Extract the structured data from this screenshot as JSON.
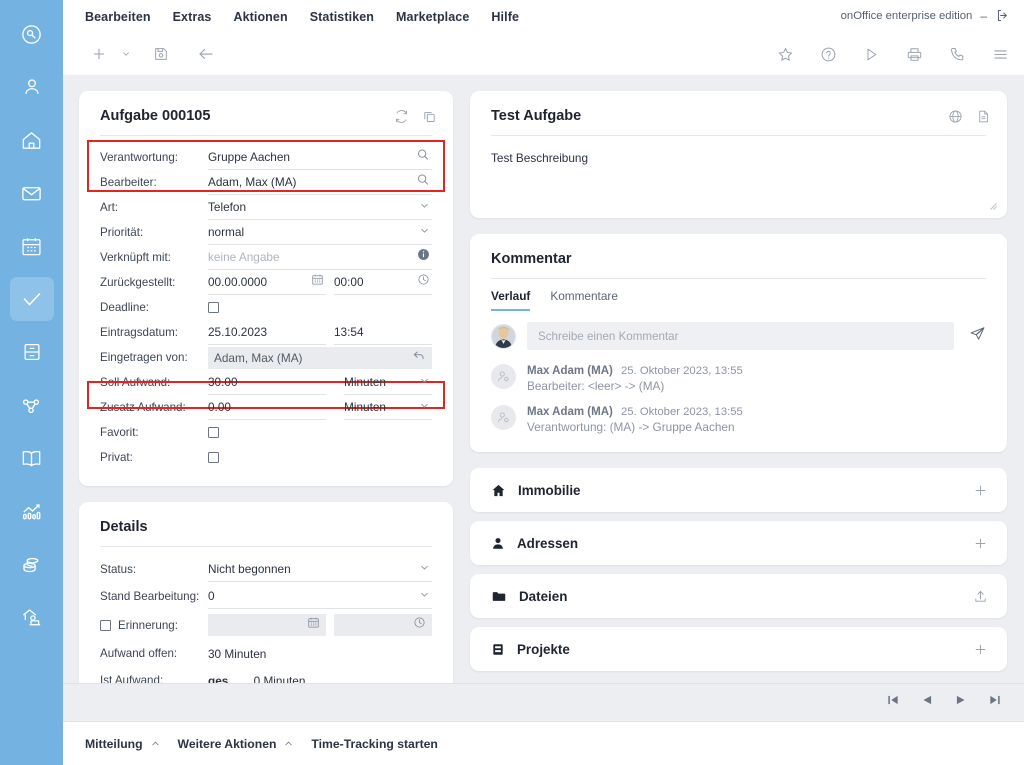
{
  "sidebar": {
    "items": [
      {
        "name": "logo-icon",
        "label": "onOffice Logo",
        "active": false
      },
      {
        "name": "contacts-icon",
        "label": "Adressen",
        "active": false
      },
      {
        "name": "properties-icon",
        "label": "Immobilien",
        "active": false
      },
      {
        "name": "mail-icon",
        "label": "E-Mail",
        "active": false
      },
      {
        "name": "calendar-icon",
        "label": "Kalender",
        "active": false
      },
      {
        "name": "tasks-icon",
        "label": "Aufgaben",
        "active": true
      },
      {
        "name": "archive-icon",
        "label": "Archiv",
        "active": false
      },
      {
        "name": "workflow-icon",
        "label": "Prozesse",
        "active": false
      },
      {
        "name": "book-icon",
        "label": "Exposés",
        "active": false
      },
      {
        "name": "statistics-icon",
        "label": "Statistiken",
        "active": false
      },
      {
        "name": "finance-icon",
        "label": "Finanzen",
        "active": false
      },
      {
        "name": "portal-icon",
        "label": "Portale",
        "active": false
      }
    ]
  },
  "topbar": {
    "menu": [
      "Bearbeiten",
      "Extras",
      "Aktionen",
      "Statistiken",
      "Marketplace",
      "Hilfe"
    ],
    "brand": "onOffice enterprise edition",
    "brand_dash": "–",
    "logout_icon": "logout-icon",
    "left_tools": [
      "plus-icon",
      "chevron-down-icon",
      "save-icon",
      "back-arrow-icon"
    ],
    "right_tools": [
      "star-icon",
      "help-icon",
      "play-icon",
      "print-icon",
      "phone-icon",
      "menu-icon"
    ]
  },
  "task_card": {
    "title": "Aufgabe 000105",
    "actions": [
      "refresh-icon",
      "copy-icon"
    ],
    "rows": [
      {
        "label": "Verantwortung:",
        "value": "Gruppe Aachen",
        "type": "search",
        "highlight": true
      },
      {
        "label": "Bearbeiter:",
        "value": "Adam, Max (MA)",
        "type": "search",
        "highlight": true
      },
      {
        "label": "Art:",
        "value": "Telefon",
        "type": "select"
      },
      {
        "label": "Priorität:",
        "value": "normal",
        "type": "select"
      },
      {
        "label": "Verknüpft mit:",
        "value": "keine Angabe",
        "type": "info",
        "muted": true
      },
      {
        "label": "Zurückgestellt:",
        "value": "00.00.0000",
        "value2": "00:00",
        "type": "datetime"
      },
      {
        "label": "Deadline:",
        "value": "",
        "type": "checkbox"
      },
      {
        "label": "Eintragsdatum:",
        "value": "25.10.2023",
        "value2": "13:54",
        "type": "readonly-datetime"
      },
      {
        "label": "Eingetragen von:",
        "value": "Adam, Max (MA)",
        "type": "readonly-undo",
        "highlight": true
      },
      {
        "label": "Soll Aufwand:",
        "value": "30.00",
        "value2": "Minuten",
        "type": "amount"
      },
      {
        "label": "Zusatz Aufwand:",
        "value": "0.00",
        "value2": "Minuten",
        "type": "amount"
      },
      {
        "label": "Favorit:",
        "value": "",
        "type": "checkbox"
      },
      {
        "label": "Privat:",
        "value": "",
        "type": "checkbox"
      }
    ]
  },
  "details_card": {
    "title": "Details",
    "rows": [
      {
        "label": "Status:",
        "value": "Nicht begonnen",
        "type": "select"
      },
      {
        "label": "Stand Bearbeitung:",
        "value": "0",
        "type": "select"
      },
      {
        "label": "Erinnerung:",
        "value": "",
        "value2": "",
        "type": "reminder",
        "checkbox_label": true
      },
      {
        "label": "Aufwand offen:",
        "value": "30 Minuten",
        "type": "text"
      },
      {
        "label": "Ist Aufwand:",
        "value": "ges.",
        "value2": "0 Minuten",
        "type": "text2"
      }
    ]
  },
  "description_card": {
    "title": "Test Aufgabe",
    "actions": [
      "globe-icon",
      "document-icon"
    ],
    "body": "Test Beschreibung"
  },
  "comment_card": {
    "title": "Kommentar",
    "tabs": [
      {
        "label": "Verlauf",
        "active": true
      },
      {
        "label": "Kommentare",
        "active": false
      }
    ],
    "input_placeholder": "Schreibe einen Kommentar",
    "send_icon": "send-icon",
    "log": [
      {
        "author": "Max Adam (MA)",
        "timestamp": "25. Oktober 2023, 13:55",
        "text": "Bearbeiter: <leer> -> (MA)"
      },
      {
        "author": "Max Adam (MA)",
        "timestamp": "25. Oktober 2023, 13:55",
        "text": "Verantwortung: (MA) -> Gruppe Aachen"
      }
    ]
  },
  "accordions": [
    {
      "label": "Immobilie",
      "icon": "home-icon",
      "action": "plus-icon"
    },
    {
      "label": "Adressen",
      "icon": "person-icon",
      "action": "plus-icon"
    },
    {
      "label": "Dateien",
      "icon": "folder-icon",
      "action": "upload-icon"
    },
    {
      "label": "Projekte",
      "icon": "project-icon",
      "action": "plus-icon"
    }
  ],
  "pager": {
    "buttons": [
      "first-page-icon",
      "previous-page-icon",
      "next-page-icon",
      "last-page-icon"
    ]
  },
  "footer": {
    "items": [
      {
        "label": "Mitteilung",
        "caret": true
      },
      {
        "label": "Weitere Aktionen",
        "caret": true
      },
      {
        "label": "Time-Tracking starten",
        "caret": false
      }
    ]
  },
  "colors": {
    "sidebar_blue": "#74b2e2",
    "sidebar_active": "#8ec2e9",
    "highlight_red": "#e8231f",
    "page_bg": "#eceef2",
    "tab_underline": "#74b2e2"
  }
}
